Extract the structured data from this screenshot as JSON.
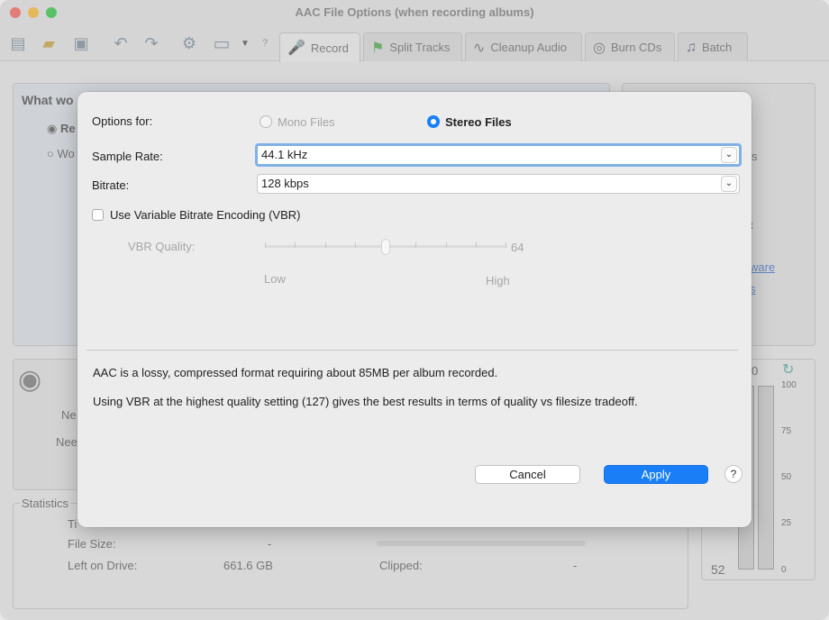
{
  "window": {
    "title": "AAC File Options (when recording albums)"
  },
  "tabs": [
    {
      "label": "Record",
      "icon": "microphone-icon"
    },
    {
      "label": "Split Tracks",
      "icon": "flag-icon"
    },
    {
      "label": "Cleanup Audio",
      "icon": "waveform-icon"
    },
    {
      "label": "Burn CDs",
      "icon": "cd-icon"
    },
    {
      "label": "Batch",
      "icon": "batch-icon"
    }
  ],
  "background": {
    "what_heading": "What wo",
    "radio1": "Re",
    "radio2": "Wo",
    "ne1": "Ne",
    "ne2": "Nee",
    "link1": "ware",
    "link2": "s",
    "right_s": "s",
    "colon": ":",
    "statistics_label": "Statistics",
    "ti": "Ti",
    "file_size_label": "File Size:",
    "file_size_value": "-",
    "left_on_drive_label": "Left on Drive:",
    "left_on_drive_value": "661.6 GB",
    "clipped_label": "Clipped:",
    "clipped_value": "-",
    "meter_top_digit": "0",
    "meter_value": "52",
    "meter_scale": [
      "100",
      "75",
      "50",
      "25",
      "0"
    ]
  },
  "dialog": {
    "options_for_label": "Options for:",
    "mono_label": "Mono Files",
    "stereo_label": "Stereo Files",
    "sample_rate_label": "Sample Rate:",
    "sample_rate_value": "44.1 kHz",
    "bitrate_label": "Bitrate:",
    "bitrate_value": "128 kbps",
    "vbr_checkbox_label": "Use Variable Bitrate Encoding (VBR)",
    "vbr_quality_label": "VBR Quality:",
    "vbr_quality_value": "64",
    "vbr_quality_level": 0.5,
    "low_label": "Low",
    "high_label": "High",
    "info_line1": "AAC is a lossy, compressed format requiring about 85MB per album recorded.",
    "info_line2": "Using VBR at the highest quality setting (127) gives the best results in terms of quality vs filesize tradeoff.",
    "cancel_label": "Cancel",
    "apply_label": "Apply",
    "help_label": "?"
  },
  "colors": {
    "accent": "#1a7ff7",
    "focus_ring": "#7fb0e8"
  }
}
